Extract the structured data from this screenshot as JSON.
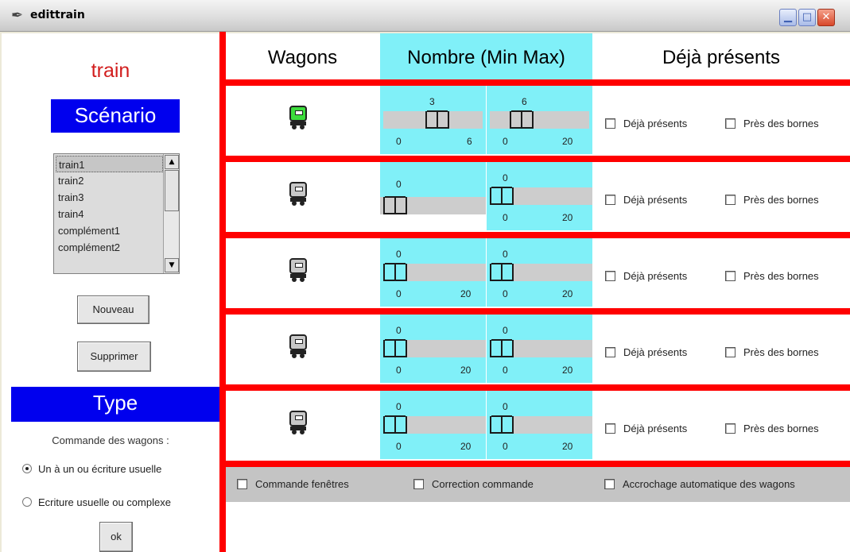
{
  "window": {
    "title": "edittrain",
    "app_icon": "feather-icon"
  },
  "left": {
    "title": "train",
    "scenario_header": "Scénario",
    "list_items": [
      "train1",
      "train2",
      "train3",
      "train4",
      "complément1",
      "complément2"
    ],
    "selected_index": 0,
    "new_button": "Nouveau",
    "delete_button": "Supprimer",
    "type_header": "Type",
    "command_label": "Commande des wagons :",
    "radio_options": [
      "Un à un ou écriture usuelle",
      "Ecriture usuelle ou complexe"
    ],
    "radio_selected": 0,
    "ok_button": "ok"
  },
  "headers": {
    "wagons": "Wagons",
    "nombre": "Nombre (Min Max)",
    "deja": "Déjà présents"
  },
  "rows": [
    {
      "wagon_color": "green",
      "min": {
        "value": "3",
        "lo": "0",
        "hi": "6"
      },
      "max": {
        "value": "6",
        "lo": "0",
        "hi": "20"
      },
      "check1": "Déjà présents",
      "check2": "Près des bornes"
    },
    {
      "wagon_color": "grey",
      "min": {
        "value": "0",
        "lo": "",
        "hi": ""
      },
      "max": {
        "value": "0",
        "lo": "0",
        "hi": "20"
      },
      "check1": "Déjà présents",
      "check2": "Près des bornes"
    },
    {
      "wagon_color": "grey",
      "min": {
        "value": "0",
        "lo": "0",
        "hi": "20"
      },
      "max": {
        "value": "0",
        "lo": "0",
        "hi": "20"
      },
      "check1": "Déjà présents",
      "check2": "Près des bornes"
    },
    {
      "wagon_color": "grey",
      "min": {
        "value": "0",
        "lo": "0",
        "hi": "20"
      },
      "max": {
        "value": "0",
        "lo": "0",
        "hi": "20"
      },
      "check1": "Déjà présents",
      "check2": "Près des bornes"
    },
    {
      "wagon_color": "grey",
      "min": {
        "value": "0",
        "lo": "0",
        "hi": "20"
      },
      "max": {
        "value": "0",
        "lo": "0",
        "hi": "20"
      },
      "check1": "Déjà présents",
      "check2": "Près des bornes"
    }
  ],
  "footer": {
    "check1": "Commande fenêtres",
    "check2": "Correction commande",
    "check3": "Accrochage automatique des wagons"
  },
  "colors": {
    "accent_red": "#ff0000",
    "header_blue": "#0000ee",
    "cyan": "#80f0f8",
    "title_red": "#d21e1e"
  }
}
